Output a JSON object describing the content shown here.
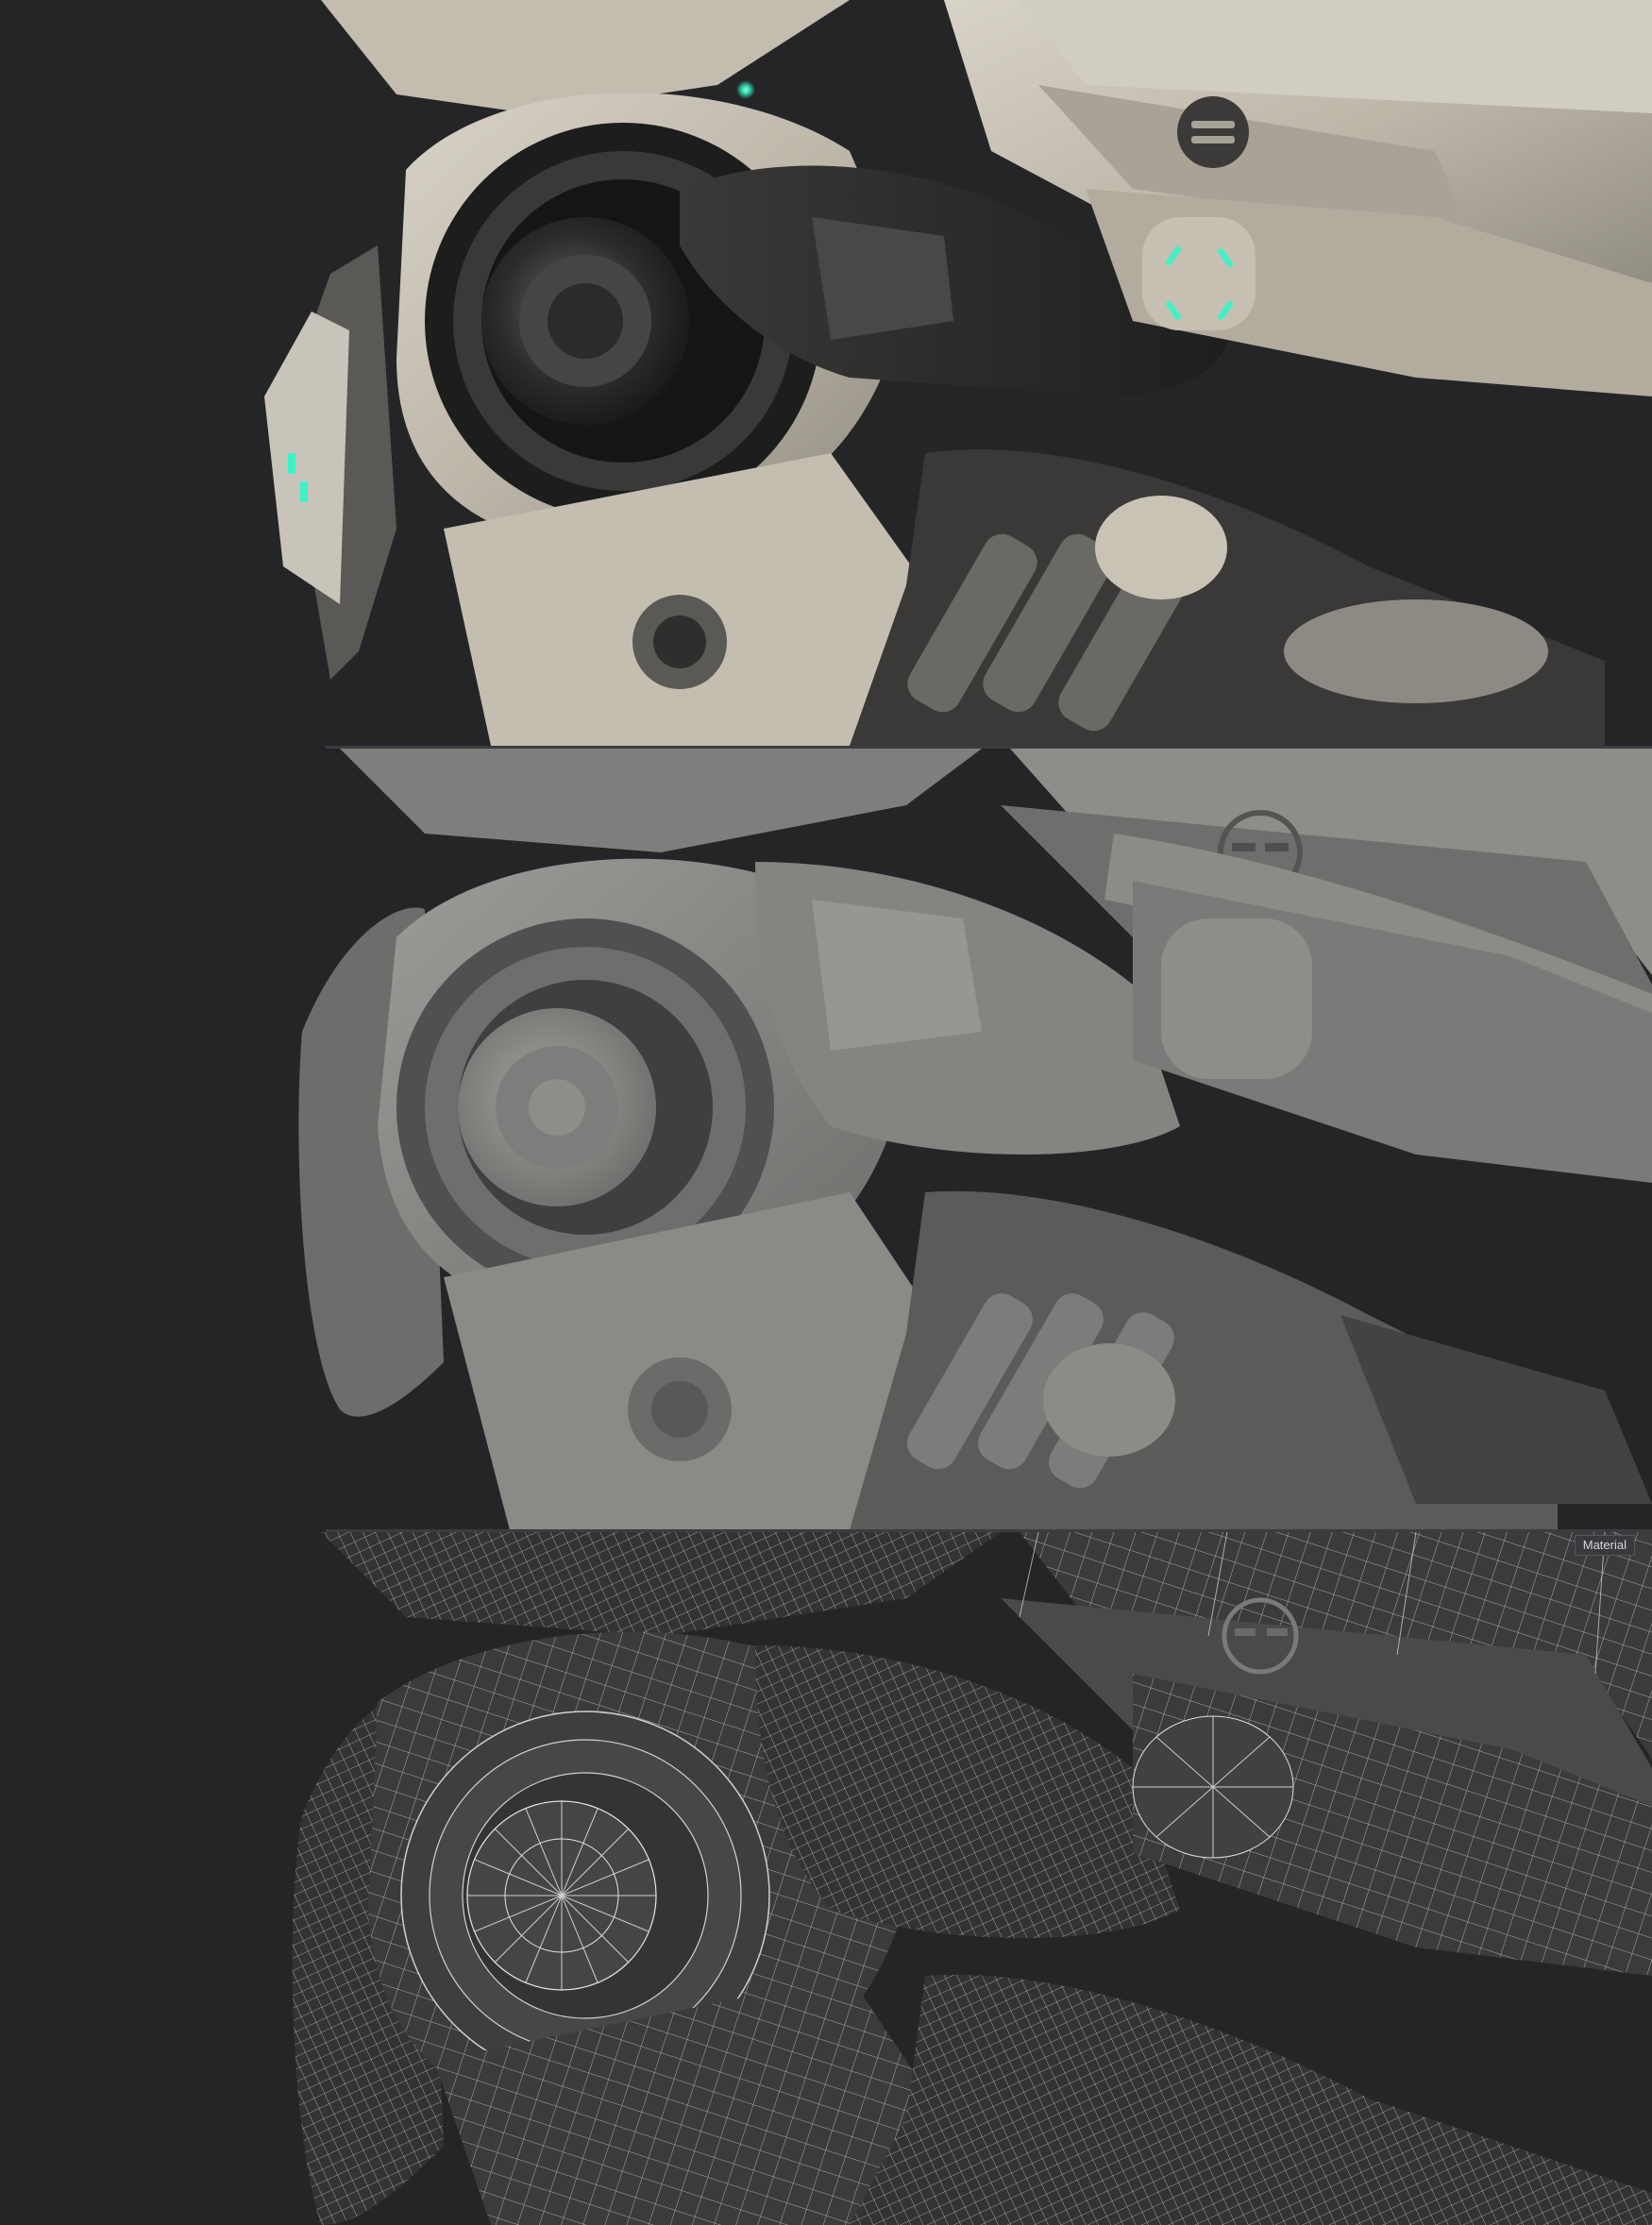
{
  "panels": [
    {
      "id": "textured",
      "description_name": "textured-render"
    },
    {
      "id": "clay",
      "description_name": "clay-render"
    },
    {
      "id": "wire",
      "description_name": "wireframe-render"
    }
  ],
  "wire_panel": {
    "material_tag": "Material"
  },
  "colors": {
    "background": "#252528",
    "textured_plate": "#bfb9ad",
    "textured_dark": "#2a2a2c",
    "clay": "#7c7c7a",
    "clay_shadow": "#4c4c4b",
    "wire_base": "#3b3b3c",
    "wire_line": "#e6e6e6",
    "glow_cyan": "#3ef2c8"
  },
  "icons": [
    "glow-light-icon"
  ]
}
